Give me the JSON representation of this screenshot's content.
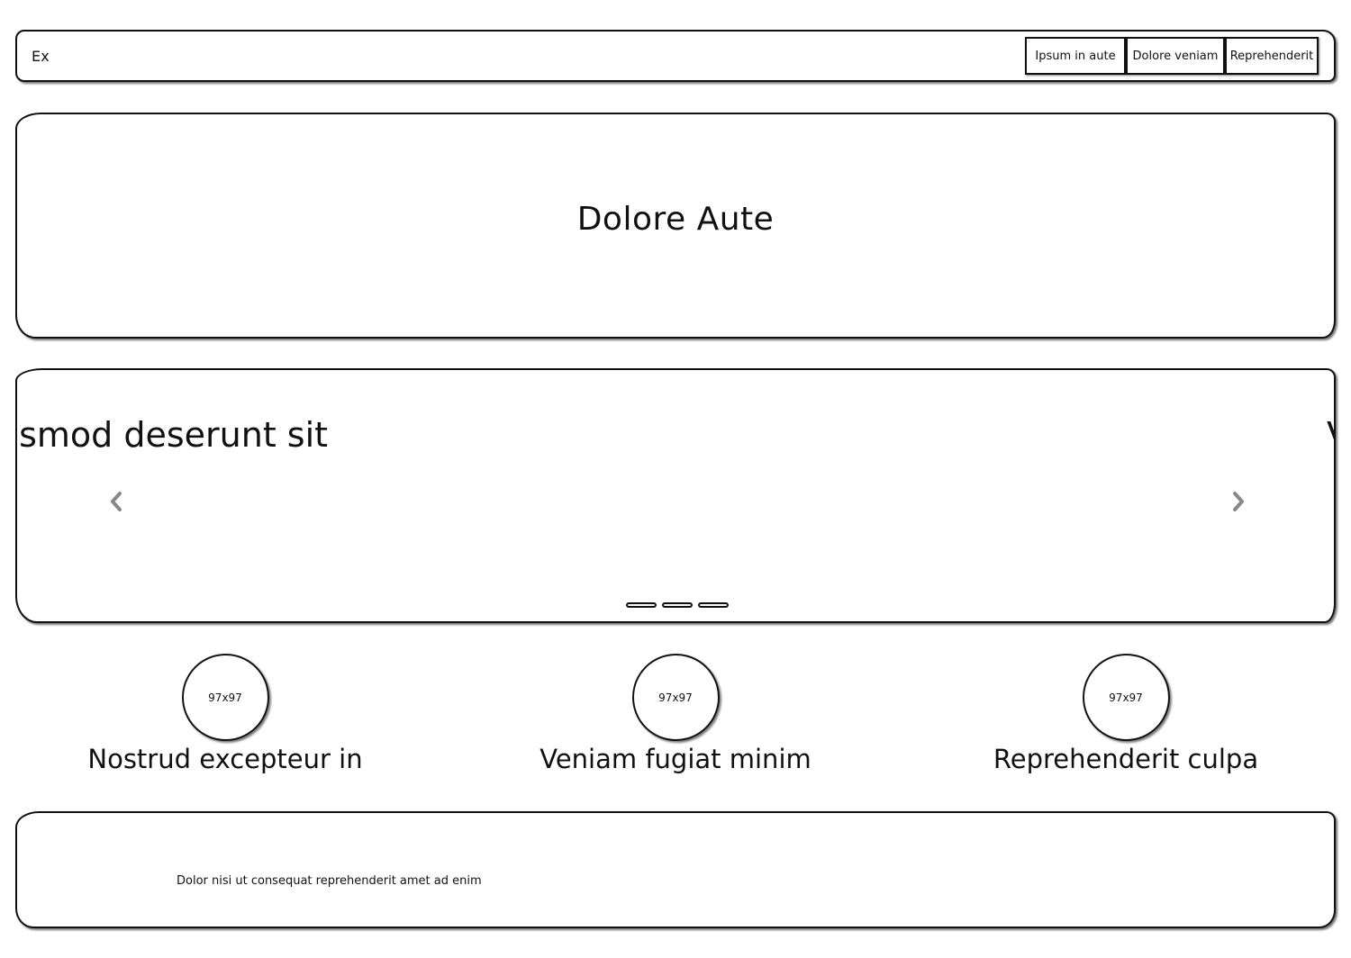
{
  "navbar": {
    "brand": "Ex",
    "buttons": [
      "Ipsum in aute",
      "Dolore veniam",
      "Reprehenderit"
    ]
  },
  "hero": {
    "title": "Dolore Aute"
  },
  "carousel": {
    "caption_left": "usmod deserunt sit",
    "caption_right": "V",
    "indicator_count": 3,
    "prev_icon": "chevron-left-icon",
    "next_icon": "chevron-right-icon",
    "arrow_color": "#888888"
  },
  "features": [
    {
      "image_label": "97x97",
      "title": "Nostrud excepteur in"
    },
    {
      "image_label": "97x97",
      "title": "Veniam fugiat minim"
    },
    {
      "image_label": "97x97",
      "title": "Reprehenderit culpa"
    }
  ],
  "footer": {
    "text": "Dolor nisi ut consequat reprehenderit amet ad enim"
  }
}
